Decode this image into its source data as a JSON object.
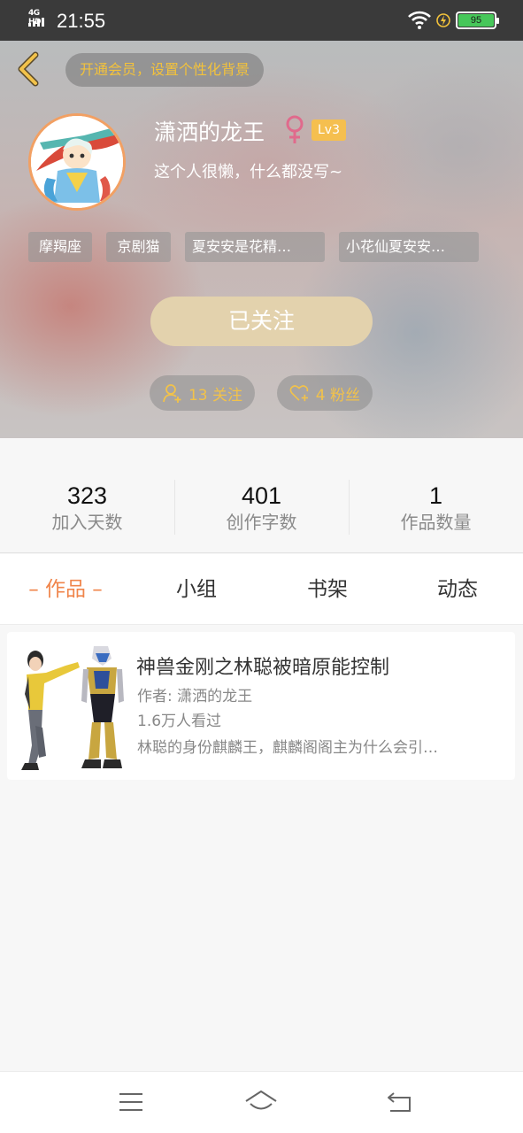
{
  "status_bar": {
    "network": "4G HD",
    "time": "21:55",
    "battery": "95",
    "battery_level": 0.95,
    "icons": [
      "signal-icon",
      "wifi-icon",
      "charging-icon",
      "battery-icon"
    ]
  },
  "header": {
    "back_icon": "chevron-left-icon",
    "vip_banner": "开通会员，设置个性化背景",
    "username": "潇洒的龙王",
    "gender_icon": "female-icon",
    "level": "Lv3",
    "bio": "这个人很懒，什么都没写~",
    "tags": [
      "摩羯座",
      "京剧猫",
      "夏安安是花精…",
      "小花仙夏安安…"
    ],
    "follow_button": "已关注",
    "following_chip": "13 关注",
    "fans_chip": "4 粉丝"
  },
  "stats": [
    {
      "value": "323",
      "label": "加入天数"
    },
    {
      "value": "401",
      "label": "创作字数"
    },
    {
      "value": "1",
      "label": "作品数量"
    }
  ],
  "tabs": [
    {
      "label": "作品",
      "active": true
    },
    {
      "label": "小组",
      "active": false
    },
    {
      "label": "书架",
      "active": false
    },
    {
      "label": "动态",
      "active": false
    }
  ],
  "works": [
    {
      "title": "神兽金刚之林聪被暗原能控制",
      "author": "作者: 潇洒的龙王",
      "views": "1.6万人看过",
      "description": "林聪的身份麒麟王，麒麟阁阁主为什么会引…"
    }
  ],
  "nav_bar": [
    "menu-icon",
    "home-icon",
    "back-icon"
  ],
  "colors": {
    "accent": "#f0854b",
    "gold": "#f2c24a",
    "follow_button": "#e3d2ad",
    "level_badge": "#f5bf4f",
    "avatar_ring": "#f2a063",
    "battery": "#47c75a"
  }
}
